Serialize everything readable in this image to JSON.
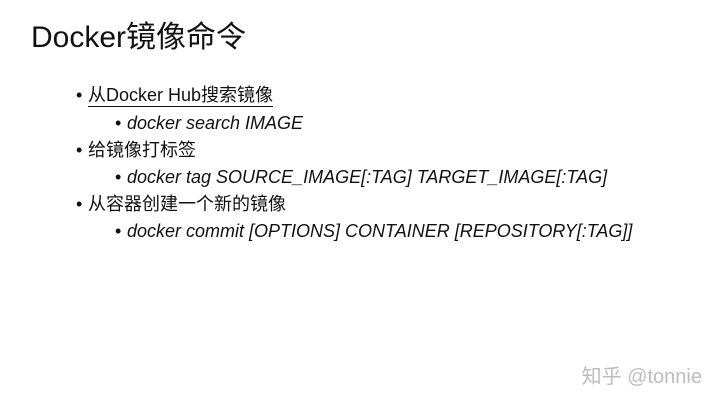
{
  "title": "Docker镜像命令",
  "bullet_symbol": "•",
  "items": [
    {
      "level": 1,
      "text": "从Docker Hub搜索镜像"
    },
    {
      "level": 2,
      "text": "docker search IMAGE"
    },
    {
      "level": 1,
      "text": "给镜像打标签"
    },
    {
      "level": 2,
      "text": "docker tag SOURCE_IMAGE[:TAG] TARGET_IMAGE[:TAG]"
    },
    {
      "level": 1,
      "text": "从容器创建一个新的镜像"
    },
    {
      "level": 2,
      "text": "docker commit [OPTIONS] CONTAINER [REPOSITORY[:TAG]]"
    }
  ],
  "watermark": "知乎 @tonnie"
}
